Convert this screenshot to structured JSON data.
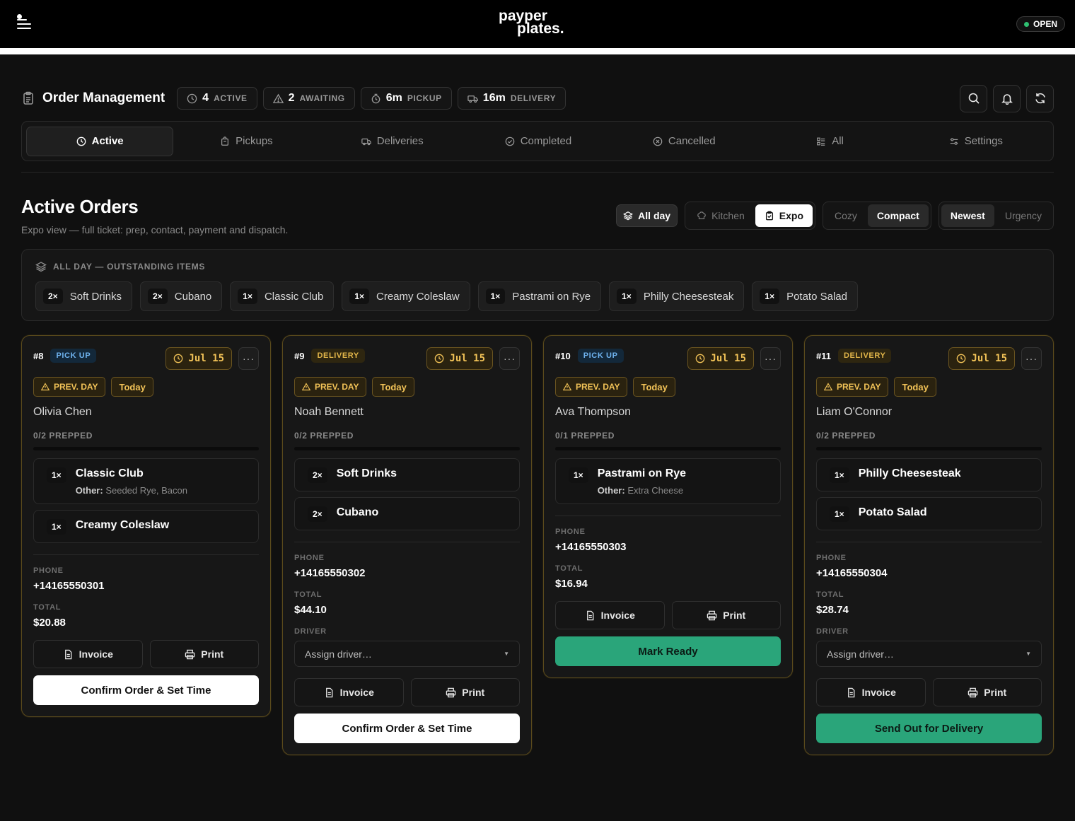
{
  "brand": {
    "line1": "payper",
    "line2": "plates."
  },
  "status": {
    "label": "OPEN",
    "color": "#2fbf71"
  },
  "header": {
    "title": "Order Management",
    "stats": [
      {
        "num": "4",
        "label": "ACTIVE",
        "icon": "clock-icon"
      },
      {
        "num": "2",
        "label": "AWAITING",
        "icon": "warning-icon"
      },
      {
        "num": "6m",
        "label": "PICKUP",
        "icon": "timer-icon"
      },
      {
        "num": "16m",
        "label": "DELIVERY",
        "icon": "truck-icon"
      }
    ],
    "actions": [
      "search-icon",
      "bell-icon",
      "refresh-icon"
    ]
  },
  "tabs": [
    "Active",
    "Pickups",
    "Deliveries",
    "Completed",
    "Cancelled",
    "All",
    "Settings"
  ],
  "section": {
    "title": "Active Orders",
    "subtitle": "Expo view — full ticket: prep, contact, payment and dispatch."
  },
  "views": {
    "allday": "All day",
    "mode": [
      "Kitchen",
      "Expo"
    ],
    "density": [
      "Cozy",
      "Compact"
    ],
    "sort": [
      "Newest",
      "Urgency"
    ]
  },
  "outstanding": {
    "heading": "ALL DAY — OUTSTANDING ITEMS",
    "items": [
      {
        "qty": "2×",
        "name": "Soft Drinks"
      },
      {
        "qty": "2×",
        "name": "Cubano"
      },
      {
        "qty": "1×",
        "name": "Classic Club"
      },
      {
        "qty": "1×",
        "name": "Creamy Coleslaw"
      },
      {
        "qty": "1×",
        "name": "Pastrami on Rye"
      },
      {
        "qty": "1×",
        "name": "Philly Cheesesteak"
      },
      {
        "qty": "1×",
        "name": "Potato Salad"
      }
    ]
  },
  "labels": {
    "prev_day": "PREV. DAY",
    "today": "Today",
    "phone": "PHONE",
    "total": "TOTAL",
    "driver": "DRIVER",
    "driver_placeholder": "Assign driver…",
    "invoice": "Invoice",
    "print": "Print",
    "more": "···"
  },
  "orders": [
    {
      "num": "#8",
      "type": "PICK UP",
      "date": "Jul 15",
      "customer": "Olivia Chen",
      "prepped": "0/2 PREPPED",
      "items": [
        {
          "qty": "1×",
          "name": "Classic Club",
          "mod_label": "Other:",
          "mod": "Seeded Rye, Bacon"
        },
        {
          "qty": "1×",
          "name": "Creamy Coleslaw"
        }
      ],
      "phone": "+14165550301",
      "total": "$20.88",
      "cta": "Confirm Order & Set Time"
    },
    {
      "num": "#9",
      "type": "DELIVERY",
      "date": "Jul 15",
      "customer": "Noah Bennett",
      "prepped": "0/2 PREPPED",
      "items": [
        {
          "qty": "2×",
          "name": "Soft Drinks"
        },
        {
          "qty": "2×",
          "name": "Cubano"
        }
      ],
      "phone": "+14165550302",
      "total": "$44.10",
      "cta": "Confirm Order & Set Time"
    },
    {
      "num": "#10",
      "type": "PICK UP",
      "date": "Jul 15",
      "customer": "Ava Thompson",
      "prepped": "0/1 PREPPED",
      "items": [
        {
          "qty": "1×",
          "name": "Pastrami on Rye",
          "mod_label": "Other:",
          "mod": "Extra Cheese"
        }
      ],
      "phone": "+14165550303",
      "total": "$16.94",
      "cta": "Mark Ready"
    },
    {
      "num": "#11",
      "type": "DELIVERY",
      "date": "Jul 15",
      "customer": "Liam O'Connor",
      "prepped": "0/2 PREPPED",
      "items": [
        {
          "qty": "1×",
          "name": "Philly Cheesesteak"
        },
        {
          "qty": "1×",
          "name": "Potato Salad"
        }
      ],
      "phone": "+14165550304",
      "total": "$28.74",
      "cta": "Send Out for Delivery"
    }
  ],
  "colors": {
    "accent_green": "#2aa57a",
    "warning_amber": "#f1c257",
    "pickup_blue": "#6fb3ef"
  }
}
